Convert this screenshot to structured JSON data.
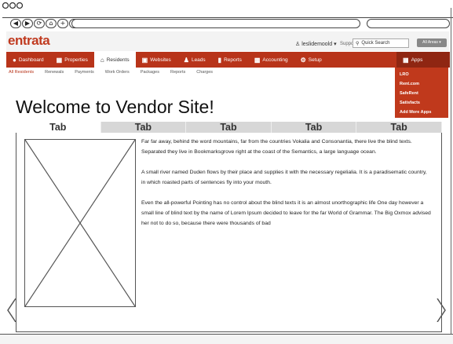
{
  "browser": {
    "nav_buttons": [
      "◀",
      "▶",
      "⟳",
      "⌂",
      "+",
      "■"
    ]
  },
  "header": {
    "logo": "entrata",
    "user": "leslidemoold",
    "user_caret": "▾",
    "support": "Support",
    "search_placeholder": "Quick Search",
    "area_select": "All Areas ▾"
  },
  "nav": {
    "items": [
      {
        "label": "Dashboard",
        "icon": "dashboard-icon"
      },
      {
        "label": "Properties",
        "icon": "building-icon"
      },
      {
        "label": "Residents",
        "icon": "home-icon"
      },
      {
        "label": "Websites",
        "icon": "window-icon"
      },
      {
        "label": "Leads",
        "icon": "people-icon"
      },
      {
        "label": "Reports",
        "icon": "bar-chart-icon"
      },
      {
        "label": "Accounting",
        "icon": "money-icon"
      },
      {
        "label": "Setup",
        "icon": "gear-icon"
      },
      {
        "label": "Apps",
        "icon": "apps-icon"
      }
    ],
    "active": "Residents"
  },
  "subnav": [
    "All Residents",
    "Renewals",
    "Payments",
    "Work Orders",
    "Packages",
    "Reports",
    "Charges"
  ],
  "apps_menu": [
    "LRO",
    "Rent.com",
    "SafeRent",
    "Satisfacts",
    "Add More Apps"
  ],
  "welcome": "Welcome to Vendor Site!",
  "tabs": [
    "Tab",
    "Tab",
    "Tab",
    "Tab",
    "Tab"
  ],
  "content": {
    "paragraphs": [
      "Far far away, behind the word mountains, far from the countries Vokalia and Consonantia, there live the blind texts. Separated they live in Bookmarksgrove right at the coast of the Semantics, a large language ocean.",
      "A small river named Duden flows by their place and supplies it with the necessary regelialia. It is a paradisematic country, in which roasted parts of sentences fly into your mouth.",
      "Even the all-powerful Pointing has no control about the blind texts it is an almost unorthographic life One day however a small line of blind text by the name of Lorem Ipsum decided to leave for the far World of Grammar. The Big Oxmox advised her not to do so, because there were thousands of bad"
    ]
  },
  "colors": {
    "brand": "#c03a1f",
    "nav_bg": "#b8341a",
    "apps_bg": "#c0391c"
  }
}
